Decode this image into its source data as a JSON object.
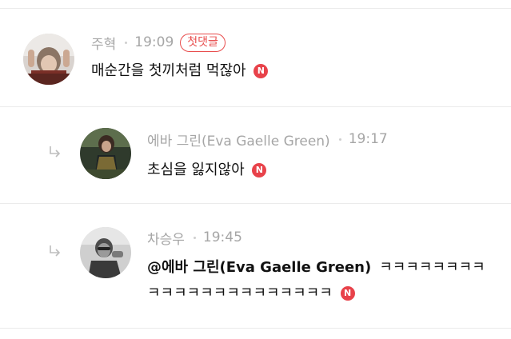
{
  "comments": [
    {
      "author": "주혁",
      "time": "19:09",
      "badge": "첫댓글",
      "text": "매순간을 첫끼처럼 먹잖아",
      "new_badge": "N"
    },
    {
      "author": "에바 그린(Eva Gaelle Green)",
      "time": "19:17",
      "text": "초심을 잃지않아",
      "new_badge": "N"
    },
    {
      "author": "차승우",
      "time": "19:45",
      "mention": "@에바 그린(Eva Gaelle Green)",
      "text": "ㅋㅋㅋㅋㅋㅋㅋㅋㅋㅋㅋㅋㅋㅋㅋㅋㅋㅋㅋㅋㅋㅋ",
      "new_badge": "N"
    }
  ],
  "colors": {
    "accent_red": "#e8424a",
    "meta_gray": "#a6a6a6",
    "divider": "#ebebeb"
  }
}
